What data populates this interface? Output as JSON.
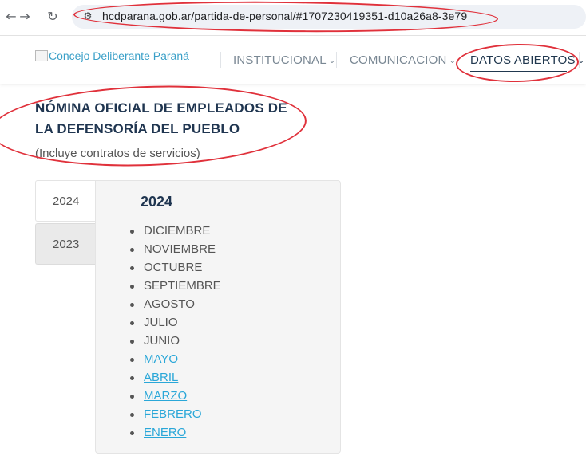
{
  "browser": {
    "back_icon": "arrow-left-icon",
    "forward_icon": "arrow-right-icon",
    "reload_icon": "reload-icon",
    "site_info_icon": "tune-icon",
    "url": "hcdparana.gob.ar/partida-de-personal/#1707230419351-d10a26a8-3e79"
  },
  "header": {
    "logo_alt": "Concejo Deliberante Paraná",
    "menu": [
      {
        "label": "INSTITUCIONAL"
      },
      {
        "label": "COMUNICACION"
      },
      {
        "label": "DATOS ABIERTOS",
        "active": true
      }
    ]
  },
  "page": {
    "title": "NÓMINA OFICIAL DE EMPLEADOS DE LA DEFENSORÍA DEL PUEBLO",
    "subtitle": "(Incluye contratos de servicios)"
  },
  "tabs": [
    {
      "label": "2024",
      "selected": true
    },
    {
      "label": "2023",
      "selected": false
    }
  ],
  "panel": {
    "year": "2024",
    "months": [
      {
        "label": "DICIEMBRE",
        "link": false
      },
      {
        "label": "NOVIEMBRE",
        "link": false
      },
      {
        "label": "OCTUBRE",
        "link": false
      },
      {
        "label": "SEPTIEMBRE",
        "link": false
      },
      {
        "label": "AGOSTO",
        "link": false
      },
      {
        "label": "JULIO",
        "link": false
      },
      {
        "label": "JUNIO",
        "link": false
      },
      {
        "label": "MAYO",
        "link": true
      },
      {
        "label": "ABRIL",
        "link": true
      },
      {
        "label": "MARZO",
        "link": true
      },
      {
        "label": "FEBRERO",
        "link": true
      },
      {
        "label": "ENERO",
        "link": true
      }
    ]
  },
  "colors": {
    "accent_link": "#2aa7d8",
    "title_navy": "#1f3550",
    "annotation_red": "#e0313b"
  }
}
